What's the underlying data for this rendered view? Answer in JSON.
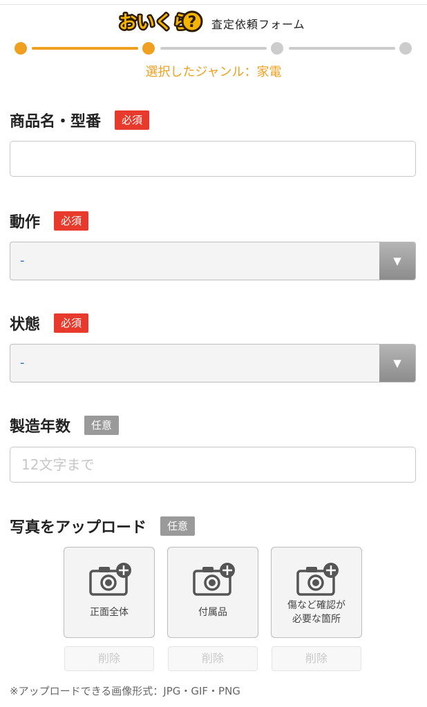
{
  "header": {
    "title": "査定依頼フォーム"
  },
  "stepper": {
    "genre_text": "選択したジャンル：家電"
  },
  "fields": {
    "product": {
      "label": "商品名・型番",
      "badge": "必須",
      "value": "",
      "placeholder": ""
    },
    "operation": {
      "label": "動作",
      "badge": "必須",
      "selected": "-"
    },
    "condition": {
      "label": "状態",
      "badge": "必須",
      "selected": "-"
    },
    "year": {
      "label": "製造年数",
      "badge": "任意",
      "placeholder": "12文字まで"
    }
  },
  "upload": {
    "label": "写真をアップロード",
    "badge": "任意",
    "slots": [
      {
        "label_line1": "正面全体",
        "label_line2": "",
        "delete_label": "削除"
      },
      {
        "label_line1": "付属品",
        "label_line2": "",
        "delete_label": "削除"
      },
      {
        "label_line1": "傷など確認が",
        "label_line2": "必要な箇所",
        "delete_label": "削除"
      }
    ],
    "note": "※アップロードできる画像形式：JPG・GIF・PNG"
  },
  "colors": {
    "accent": "#f0a020",
    "inactive": "#cccccc",
    "required": "#e83a2c",
    "optional": "#9a9a9a"
  }
}
